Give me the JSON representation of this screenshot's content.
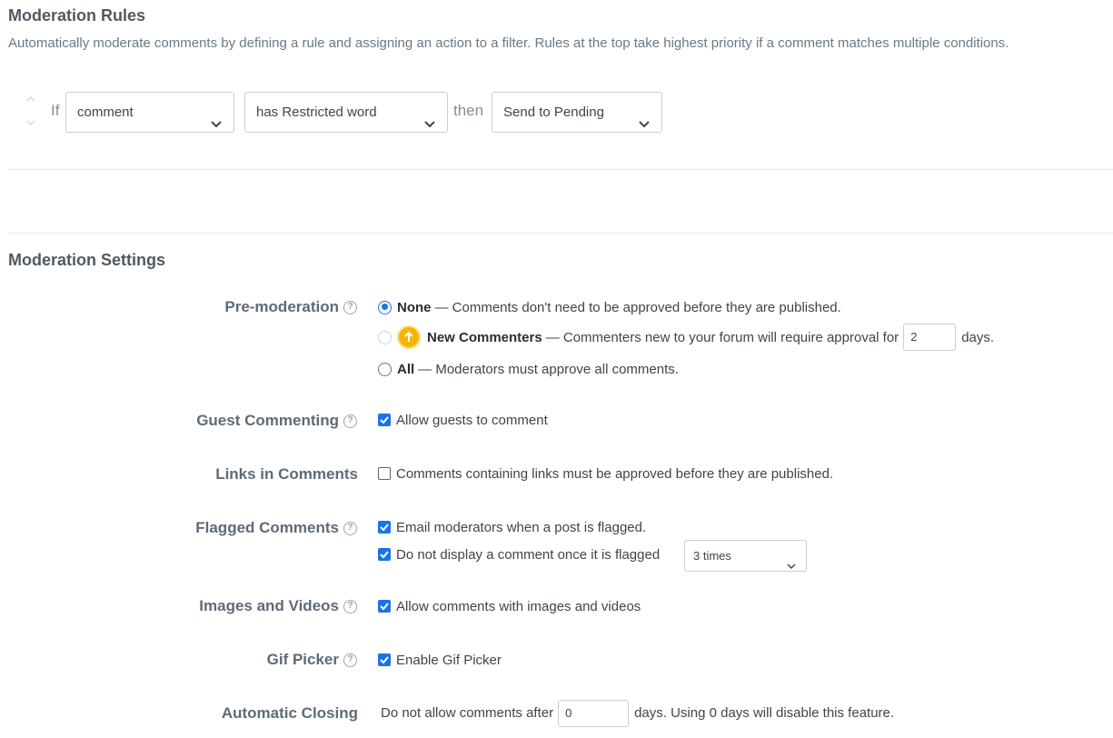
{
  "rules": {
    "title": "Moderation Rules",
    "description": "Automatically moderate comments by defining a rule and assigning an action to a filter. Rules at the top take highest priority if a comment matches multiple conditions.",
    "if_word": "If",
    "then_word": "then",
    "field_select": "comment",
    "condition_select": "has Restricted word",
    "action_select": "Send to Pending"
  },
  "settings": {
    "title": "Moderation Settings",
    "premoderation": {
      "label": "Pre-moderation",
      "none_title": "None",
      "none_text": "— Comments don't need to be approved before they are published.",
      "new_title": "New Commenters",
      "new_text": "— Commenters new to your forum will require approval for",
      "new_days_value": "2",
      "new_days_suffix": "days.",
      "all_title": "All",
      "all_text": "— Moderators must approve all comments.",
      "selected": "None"
    },
    "guest": {
      "label": "Guest Commenting",
      "option": "Allow guests to comment",
      "checked": true
    },
    "links": {
      "label": "Links in Comments",
      "option": "Comments containing links must be approved before they are published.",
      "checked": false
    },
    "flagged": {
      "label": "Flagged Comments",
      "option1": "Email moderators when a post is flagged.",
      "option1_checked": true,
      "option2": "Do not display a comment once it is flagged",
      "option2_checked": true,
      "times_select": "3 times"
    },
    "media": {
      "label": "Images and Videos",
      "option": "Allow comments with images and videos",
      "checked": true
    },
    "gif": {
      "label": "Gif Picker",
      "option": "Enable Gif Picker",
      "checked": true
    },
    "closing": {
      "label": "Automatic Closing",
      "prefix": "Do not allow comments after",
      "value": "0",
      "suffix": "days. Using 0 days will disable this feature."
    }
  },
  "colors": {
    "accent": "#1a73e8",
    "upgrade": "#f5b400"
  },
  "icons": {
    "help": "question-circle-icon",
    "chevron": "chevron-down-icon",
    "upgrade": "arrow-up-circle-icon"
  }
}
